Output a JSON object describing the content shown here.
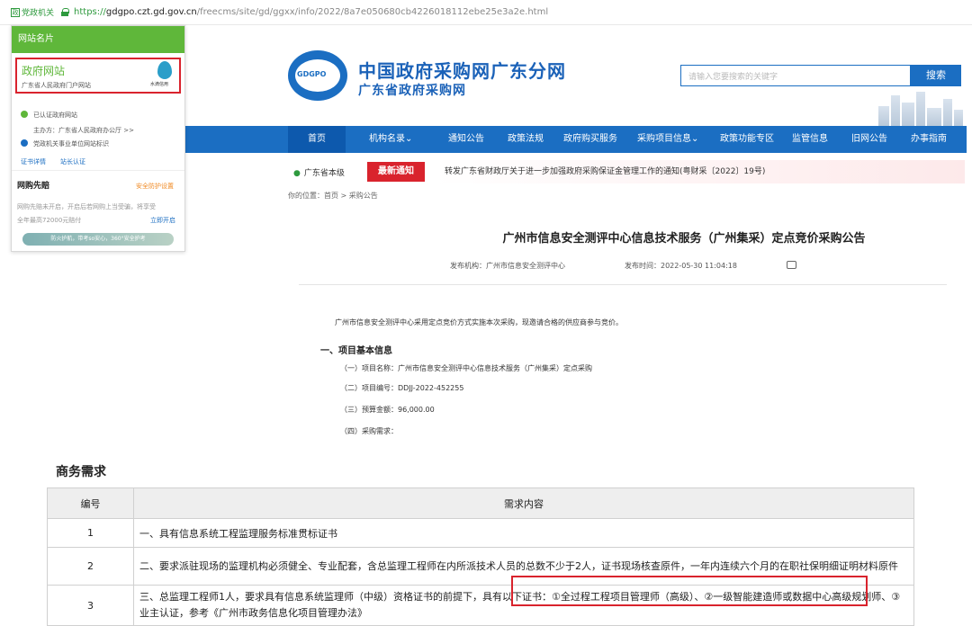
{
  "browser": {
    "badge": "党政机关",
    "url_https": "https://",
    "url_host": "gdgpo.czt.gd.gov.cn",
    "url_path": "/freecms/site/gd/ggxx/info/2022/8a7e050680cb4226018112ebe25e3a2e.html"
  },
  "site": {
    "logo_text": "GDGPO",
    "title": "中国政府采购网广东分网",
    "subtitle": "广东省政府采购网",
    "search_placeholder": "请输入您要搜索的关键字",
    "search_button": "搜索"
  },
  "nav": {
    "items": [
      "首页",
      "机构名录",
      "通知公告",
      "政策法规",
      "政府购买服务",
      "采购项目信息",
      "政策功能专区",
      "监管信息",
      "旧网公告",
      "办事指南"
    ]
  },
  "notice": {
    "region": "广东省本级",
    "latest_label": "最新通知",
    "text": "转发广东省财政厅关于进一步加强政府采购保证金管理工作的通知(粤财采〔2022〕19号)"
  },
  "breadcrumb": "你的位置：首页 > 采购公告",
  "article": {
    "title": "广州市信息安全测评中心信息技术服务（广州集采）定点竞价采购公告",
    "publisher": "发布机构：广州市信息安全测评中心",
    "publish_time": "发布时间：2022-05-30 11:04:18",
    "intro": "广州市信息安全测评中心采用定点竞价方式实施本次采购，现邀请合格的供应商参与竞价。",
    "section1": "一、项目基本信息",
    "lines": [
      "（一）项目名称：广州市信息安全测评中心信息技术服务（广州集采）定点采购",
      "（二）项目编号：DDJJ-2022-452255",
      "（三）预算金额：96,000.00",
      "（四）采购需求："
    ]
  },
  "popup": {
    "header": "网站名片",
    "card_title": "政府网站",
    "card_sub": "广东省人民政府门户网站",
    "seal_label": "水滴信用",
    "verified": "已认证政府网站",
    "sponsor": "主办方：广东省人民政府办公厅 >>",
    "gov_mark": "党政机关事业单位网站标识",
    "link_cert": "证书详情",
    "link_report": "站长认证",
    "shop_title": "网购先赔",
    "shop_setting": "安全防护设置",
    "shop_desc1": "网购先赔未开启，开启后若网购上当受骗，将享受",
    "shop_desc2": "全年最高72000元赔付",
    "shop_open": "立即开启",
    "banner": "防火护航，带考so安心，360°安全护考"
  },
  "requirements": {
    "title": "商务需求",
    "col_num": "编号",
    "col_content": "需求内容",
    "rows": [
      {
        "num": "1",
        "text": "一、具有信息系统工程监理服务标准贯标证书"
      },
      {
        "num": "2",
        "text": "二、要求派驻现场的监理机构必须健全、专业配套，含总监理工程师在内所派技术人员的总数不少于2人，证书现场核查原件，一年内连续六个月的在职社保明细证明材料原件"
      },
      {
        "num": "3",
        "text": "三、总监理工程师1人，要求具有信息系统监理师（中级）资格证书的前提下，具有以下证书：①全过程工程项目管理师（高级）、②一级智能建造师或数据中心高级规划师、③业主认证，参考《广州市政务信息化项目管理办法》"
      }
    ]
  },
  "colors": {
    "brand_blue": "#1b6ec2",
    "popup_green": "#5fb73a",
    "alert_red": "#d9232d"
  }
}
